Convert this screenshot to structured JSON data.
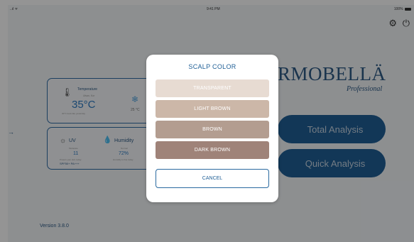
{
  "status_bar": {
    "signal": "..ıl ᯤ",
    "time": "9:41 PM",
    "battery": "100%"
  },
  "top_icons": {
    "settings": "⚙",
    "power": "⏻"
  },
  "logo": {
    "text": "RMOBELLÄ",
    "subtitle": "Professional"
  },
  "buttons": {
    "total_analysis": "Total Analysis",
    "quick_analysis": "Quick Analysis"
  },
  "temperature_card": {
    "label": "Temperature",
    "location": "Ulsan, Kor",
    "value": "35°C",
    "description": "30°C feels like yesterday",
    "outdoor_value": "25 °C",
    "icon": "thermometer-icon",
    "snow_icon": "snowflake-icon"
  },
  "env_card": {
    "uv_label": "UV",
    "uv_sub": "Moderate",
    "uv_value": "11",
    "uv_advice": "Protect your skin today",
    "spf": "SPF50+ PA+++",
    "humidity_label": "Humidity",
    "humidity_sub": "Normal",
    "humidity_value": "72%",
    "humidity_desc": "Humidity is fine today"
  },
  "version": "Version 3.8.0",
  "modal": {
    "title": "SCALP COLOR",
    "options": [
      "TRANSPARENT",
      "LIGHT BROWN",
      "BROWN",
      "DARK BROWN"
    ],
    "cancel": "CANCEL"
  },
  "colors": {
    "brand": "#1f5f96",
    "option_transparent": "#e7dbd2",
    "option_light_brown": "#ccb7a8",
    "option_brown": "#b39d90",
    "option_dark_brown": "#9f8379"
  }
}
